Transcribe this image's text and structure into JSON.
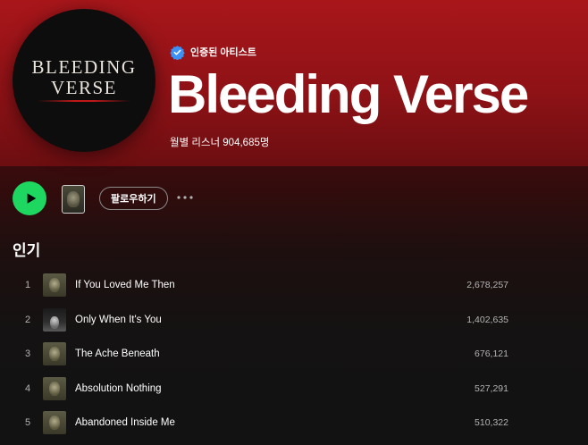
{
  "artist": {
    "verified_label": "인증된 아티스트",
    "name": "Bleeding Verse",
    "monthly_listeners": "월별 리스너 904,685명",
    "avatar_logo_line1": "BLEEDING",
    "avatar_logo_line2": "VERSE"
  },
  "controls": {
    "follow_label": "팔로우하기"
  },
  "popular": {
    "heading": "인기",
    "tracks": [
      {
        "num": "1",
        "title": "If You Loved Me Then",
        "plays": "2,678,257"
      },
      {
        "num": "2",
        "title": "Only When It's You",
        "plays": "1,402,635"
      },
      {
        "num": "3",
        "title": "The Ache Beneath",
        "plays": "676,121"
      },
      {
        "num": "4",
        "title": "Absolution Nothing",
        "plays": "527,291"
      },
      {
        "num": "5",
        "title": "Abandoned Inside Me",
        "plays": "510,322"
      }
    ]
  },
  "colors": {
    "hero": "#a8161a",
    "play_button": "#1ed760",
    "verified": "#3d91f4"
  },
  "icons": {
    "verified": "verified-badge-icon",
    "play": "play-icon",
    "more": "more-icon"
  }
}
